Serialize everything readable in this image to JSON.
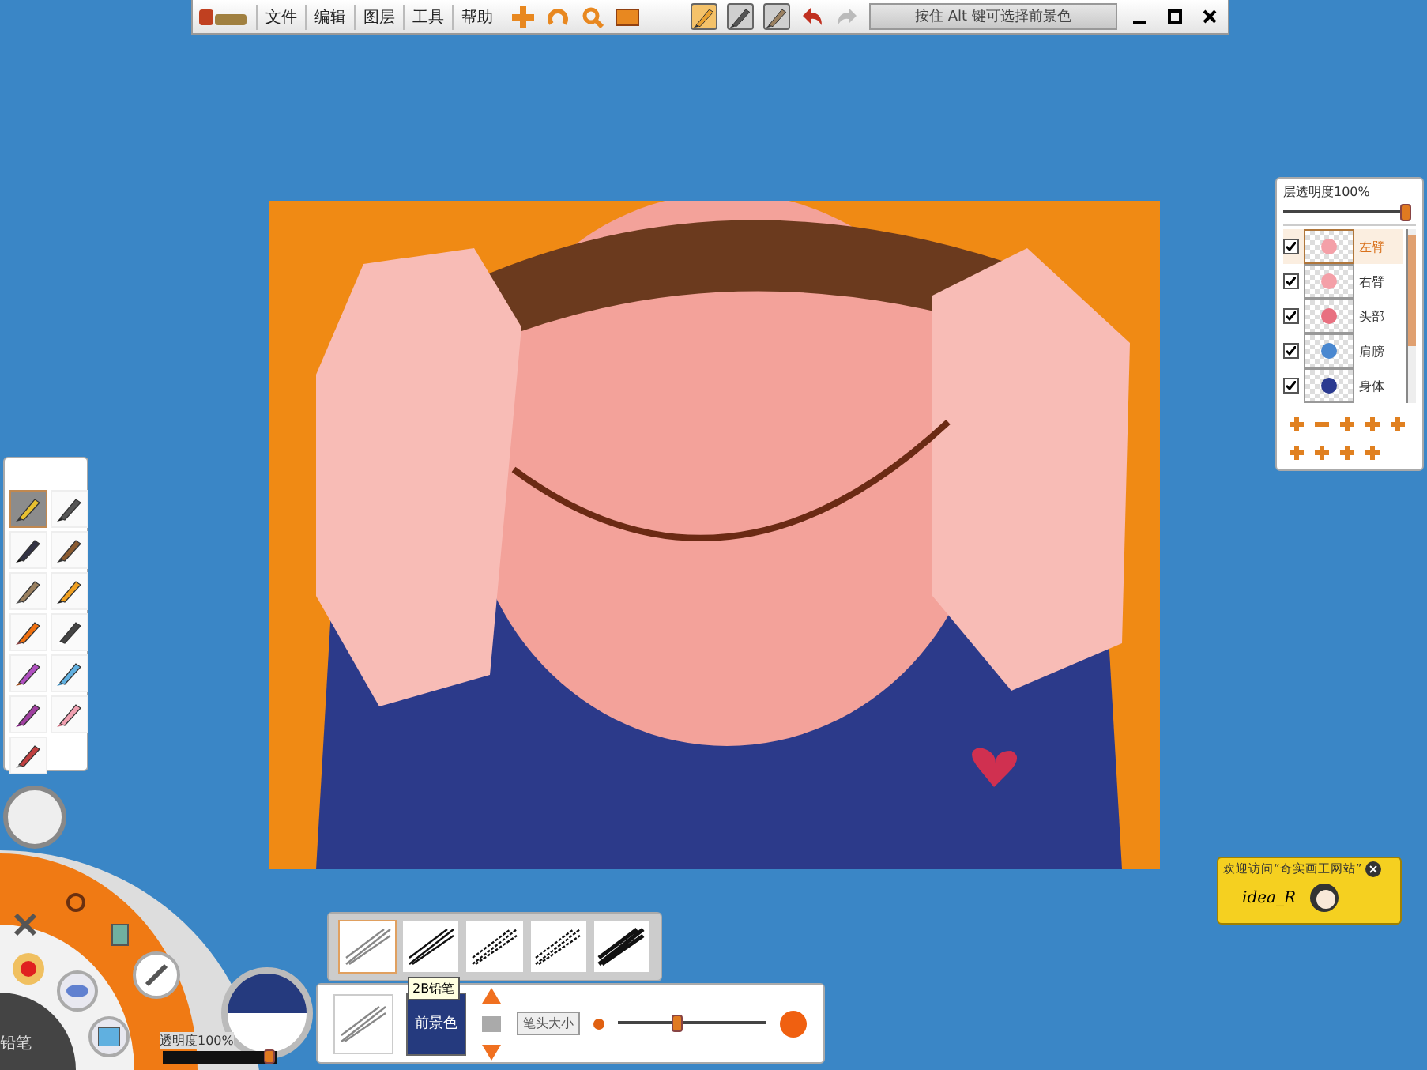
{
  "toolbar": {
    "menu": [
      "文件",
      "编辑",
      "图层",
      "工具",
      "帮助"
    ],
    "tools": [
      {
        "selected": true
      },
      {
        "selected": false
      },
      {
        "selected": false
      }
    ],
    "hint": "按住 Alt 键可选择前景色"
  },
  "layers_panel": {
    "opacity": {
      "label": "层透明度100%",
      "level": 0.97
    },
    "layers": [
      {
        "name": "左臂",
        "visible": true,
        "selected": true
      },
      {
        "name": "右臂",
        "visible": true,
        "selected": false
      },
      {
        "name": "头部",
        "visible": true,
        "selected": false
      },
      {
        "name": "肩膀",
        "visible": true,
        "selected": false
      },
      {
        "name": "身体",
        "visible": true,
        "selected": false
      }
    ]
  },
  "toolbox": {
    "tools": [
      {
        "selected": true
      },
      {
        "selected": false
      },
      {
        "selected": false
      },
      {
        "selected": false
      },
      {
        "selected": false
      },
      {
        "selected": false
      },
      {
        "selected": false
      },
      {
        "selected": false
      },
      {
        "selected": false
      },
      {
        "selected": false
      },
      {
        "selected": false
      },
      {
        "selected": false
      },
      {
        "selected": false
      }
    ]
  },
  "dial": {
    "current_tool": "铅笔",
    "opacity": {
      "label": "透明度100%",
      "level": 0.95
    }
  },
  "brush_panel": {
    "presets": [
      {
        "selected": true
      },
      {
        "selected": false
      },
      {
        "selected": false
      },
      {
        "selected": false
      },
      {
        "selected": false
      }
    ],
    "tooltip": "2B铅笔"
  },
  "brush_bar": {
    "color_label": "前景色",
    "size_label": "笔头大小",
    "size": {
      "level": 0.4
    }
  },
  "ad": {
    "text": "欢迎访问“奇实画王网站”",
    "logo": "idea_R"
  }
}
